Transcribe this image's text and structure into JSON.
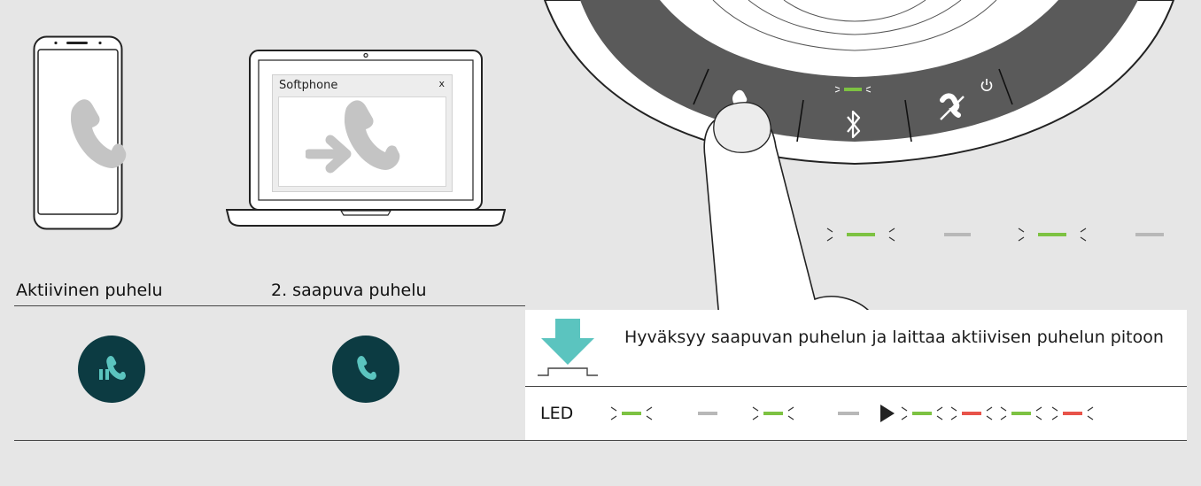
{
  "laptop": {
    "window_title": "Softphone",
    "close_label": "x"
  },
  "labels": {
    "active_call": "Aktiivinen puhelu",
    "second_call": "2. saapuva puhelu"
  },
  "action": {
    "description": "Hyväksyy saapuvan puhelun ja laittaa aktiivisen puhelun pitoon",
    "led_label": "LED"
  },
  "colors": {
    "background": "#e6e6e6",
    "led_green": "#7dc242",
    "led_red": "#e8534a",
    "led_off": "#b8b8b8",
    "accent_teal": "#5bc4bf",
    "button_dark": "#0c3b42"
  },
  "led_sequence_top": [
    "green-blink",
    "off",
    "green-blink",
    "off"
  ],
  "led_sequence_bottom": [
    "green-blink",
    "off",
    "green-blink",
    "off",
    "arrow",
    "green-blink",
    "red-blink",
    "green-blink",
    "red-blink"
  ],
  "icons": {
    "phone": "phone-handset-icon",
    "softphone": "softphone-incoming-icon",
    "active_call": "call-hold-icon",
    "incoming_call": "call-answer-icon",
    "press": "press-down-arrow-icon",
    "bluetooth": "bluetooth-icon",
    "hangup": "end-call-icon",
    "power": "power-icon"
  }
}
